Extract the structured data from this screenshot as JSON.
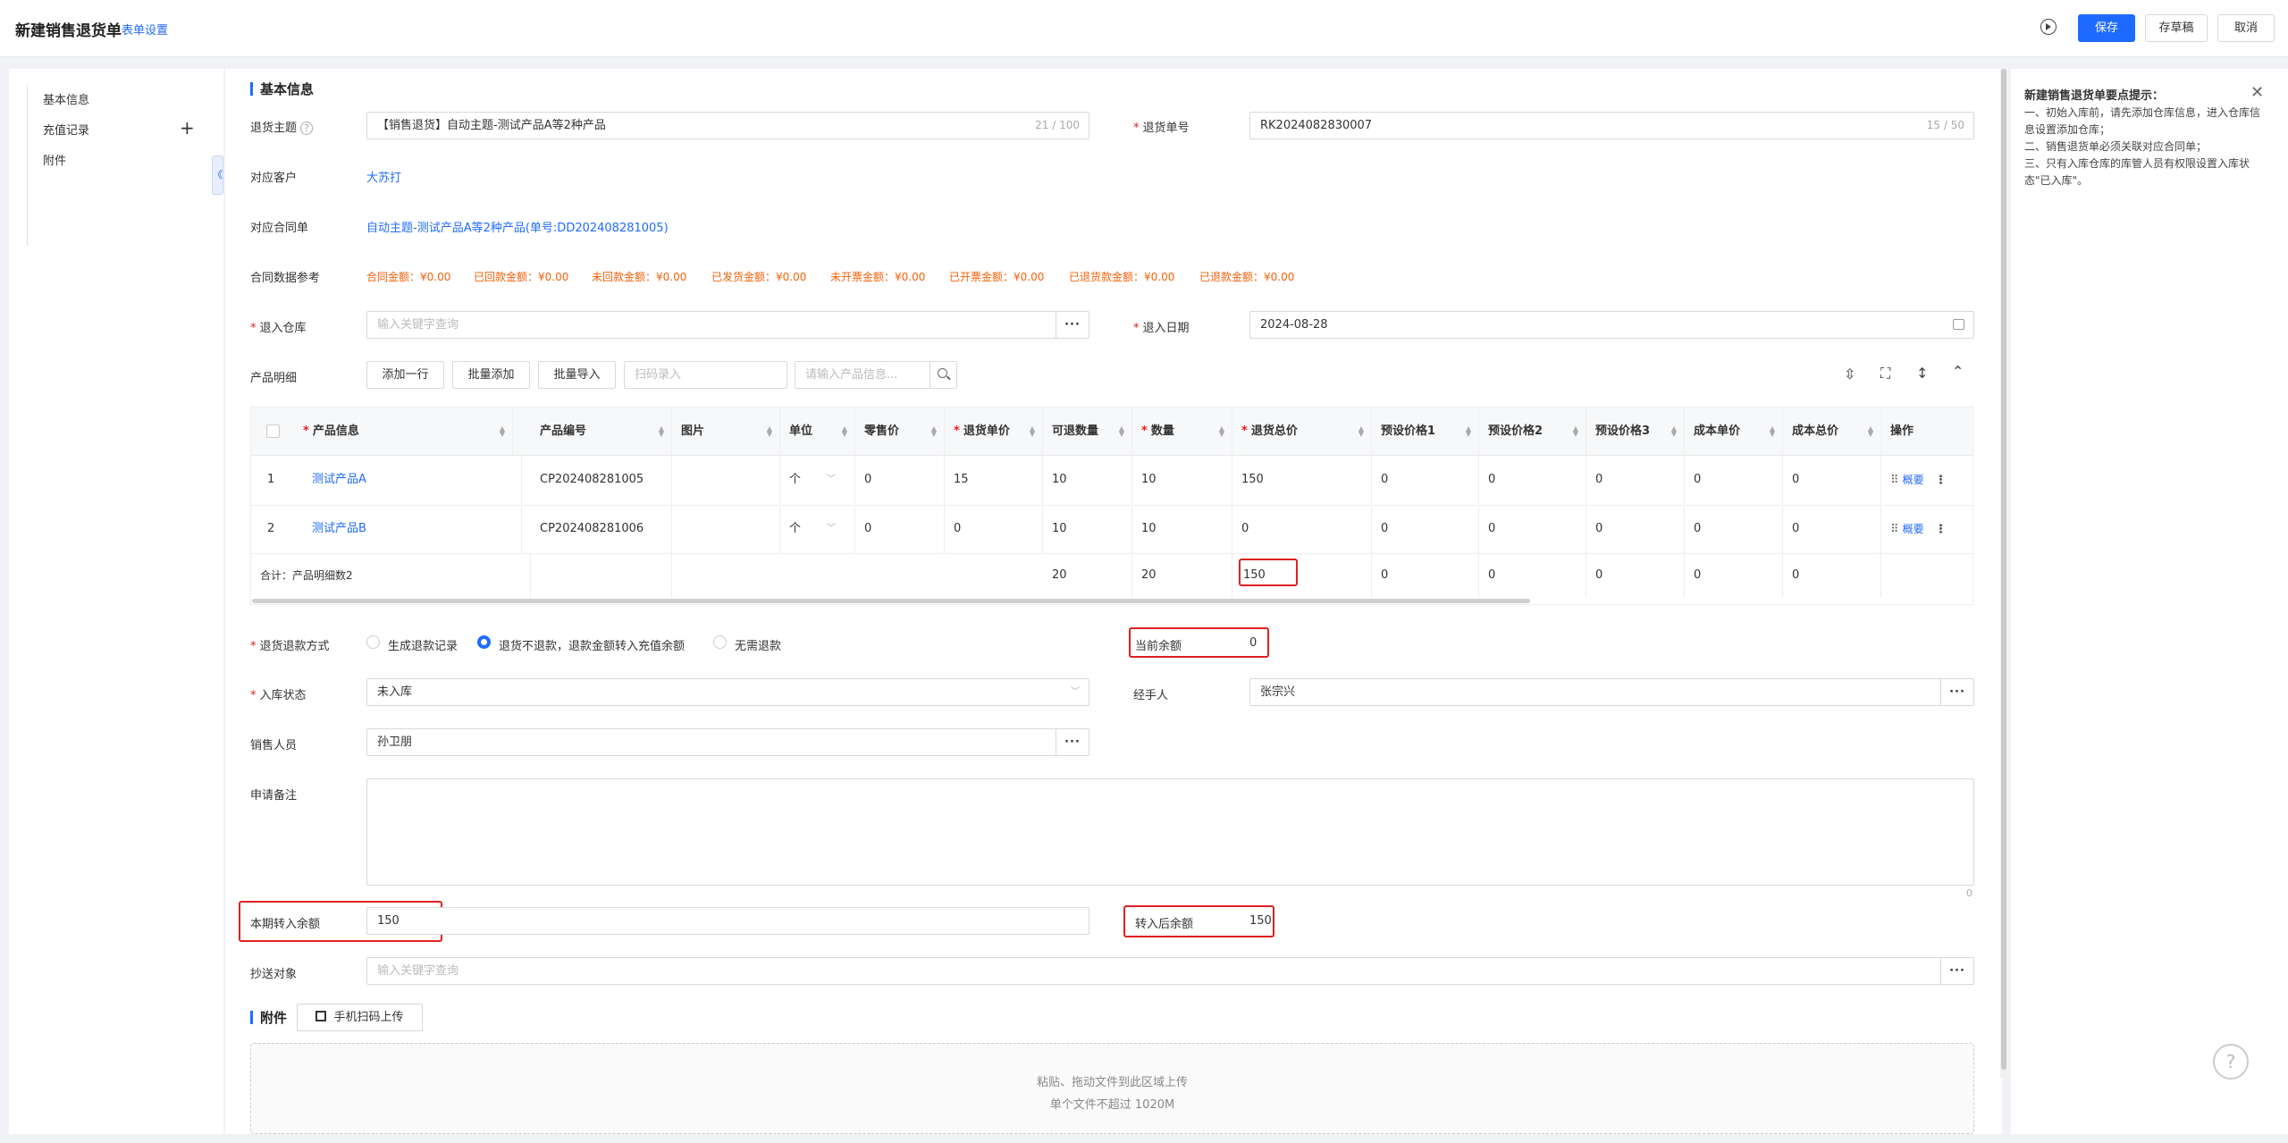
{
  "header": {
    "title": "新建销售退货单",
    "form_settings": "表单设置",
    "save": "保存",
    "draft": "存草稿",
    "cancel": "取消"
  },
  "nav": {
    "items": [
      "基本信息",
      "充值记录",
      "附件"
    ],
    "plus": "+",
    "collapse": "《"
  },
  "section": {
    "basic": "基本信息",
    "attachment": "附件"
  },
  "form": {
    "subject_label": "退货主题",
    "subject_value": "【销售退货】自动主题-测试产品A等2种产品",
    "subject_count": "21 / 100",
    "number_label": "退货单号",
    "number_value": "RK2024082830007",
    "number_count": "15 / 50",
    "customer_label": "对应客户",
    "customer_value": "大苏打",
    "contract_label": "对应合同单",
    "contract_value": "自动主题-测试产品A等2种产品(单号:DD202408281005)",
    "contract_ref_label": "合同数据参考",
    "contract_ref": [
      "合同金额：¥0.00",
      "已回款金额：¥0.00",
      "未回款金额：¥0.00",
      "已发货金额：¥0.00",
      "未开票金额：¥0.00",
      "已开票金额：¥0.00",
      "已退货款金额：¥0.00",
      "已退款金额：¥0.00"
    ],
    "warehouse_label": "退入仓库",
    "warehouse_placeholder": "输入关键字查询",
    "date_label": "退入日期",
    "date_value": "2024-08-28",
    "products_label": "产品明细",
    "add_row": "添加一行",
    "batch_add": "批量添加",
    "batch_import": "批量导入",
    "scan_placeholder": "扫码录入",
    "product_search_placeholder": "请输入产品信息...",
    "refund_method_label": "退货退款方式",
    "refund_options": [
      "生成退款记录",
      "退货不退款，退款金额转入充值余额",
      "无需退款"
    ],
    "balance_label": "当前余额",
    "balance_value": "0",
    "status_label": "入库状态",
    "status_value": "未入库",
    "handler_label": "经手人",
    "handler_value": "张宗兴",
    "sales_label": "销售人员",
    "sales_value": "孙卫朋",
    "remark_label": "申请备注",
    "remark_count": "0",
    "transfer_label": "本期转入余额",
    "transfer_value": "150",
    "after_label": "转入后余额",
    "after_value": "150",
    "cc_label": "抄送对象",
    "cc_placeholder": "输入关键字查询",
    "mobile_upload": "手机扫码上传",
    "upload_hint1": "粘贴、拖动文件到此区域上传",
    "upload_hint2": "单个文件不超过 1020M",
    "dots": "···"
  },
  "table": {
    "headers": [
      "产品信息",
      "产品编号",
      "图片",
      "单位",
      "零售价",
      "退货单价",
      "可退数量",
      "数量",
      "退货总价",
      "预设价格1",
      "预设价格2",
      "预设价格3",
      "成本单价",
      "成本总价",
      "操作"
    ],
    "rows": [
      {
        "idx": "1",
        "name": "测试产品A",
        "code": "CP202408281005",
        "unit": "个",
        "retail": "0",
        "price": "15",
        "avail": "10",
        "qty": "10",
        "total": "150",
        "p1": "0",
        "p2": "0",
        "p3": "0",
        "cost": "0",
        "cost_total": "0",
        "op": "概要"
      },
      {
        "idx": "2",
        "name": "测试产品B",
        "code": "CP202408281006",
        "unit": "个",
        "retail": "0",
        "price": "0",
        "avail": "10",
        "qty": "10",
        "total": "0",
        "p1": "0",
        "p2": "0",
        "p3": "0",
        "cost": "0",
        "cost_total": "0",
        "op": "概要"
      }
    ],
    "summary": {
      "label": "合计：产品明细数2",
      "avail": "20",
      "qty": "20",
      "total": "150",
      "p1": "0",
      "p2": "0",
      "p3": "0",
      "cost": "0",
      "cost_total": "0"
    }
  },
  "tips": {
    "title": "新建销售退货单要点提示：",
    "lines": [
      "一、初始入库前，请先添加仓库信息，进入仓库信息设置添加仓库；",
      "二、销售退货单必须关联对应合同单；",
      "三、只有入库仓库的库管人员有权限设置入库状态\"已入库\"。"
    ]
  },
  "colors": {
    "accent": "#1f6bff",
    "highlight": "#e02020",
    "orange": "#f5610a"
  }
}
